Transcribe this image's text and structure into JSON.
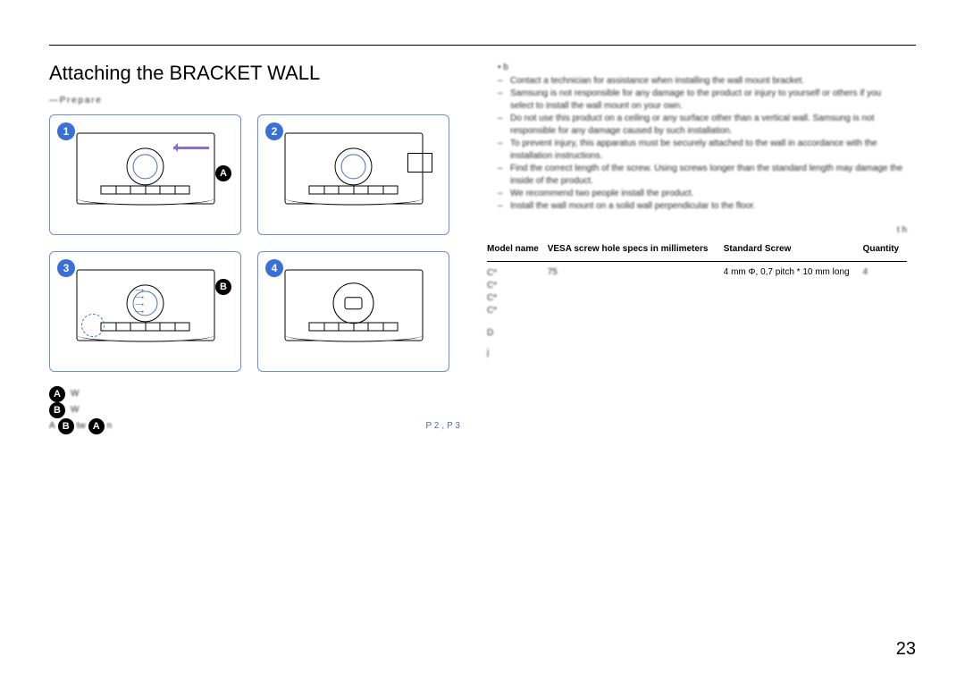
{
  "title": "Attaching the BRACKET WALL",
  "pre_note": "― P r e p a r e",
  "steps": {
    "s1": "1",
    "s2": "2",
    "s3": "3",
    "s4": "4"
  },
  "letters": {
    "A": "A",
    "B": "B"
  },
  "legend": {
    "a_text": "W",
    "b_text": "W",
    "line3_prefix": "A",
    "line3_b": "tw",
    "line3_a": "n",
    "link1": "P 2",
    "link_sep": " , ",
    "link2": "P 3"
  },
  "right": {
    "head_bullet": "b",
    "subs": [
      "Contact a technician for assistance when installing the wall mount bracket.",
      "Samsung is not responsible for any damage to the product or injury to yourself or others if you select to install the wall mount on your own.",
      "Do not use this product on a ceiling or any surface other than a vertical wall. Samsung is not responsible for any damage caused by such installation.",
      "To prevent injury, this apparatus must be securely attached to the wall in accordance with the installation instructions.",
      "Find the correct length of the screw. Using screws longer than the standard length may damage the inside of the product.",
      "We recommend two people install the product.",
      "Install the wall mount on a solid wall perpendicular to the floor."
    ],
    "pre_table_note": "t h"
  },
  "table": {
    "headers": {
      "model": "Model name",
      "vesa": "VESA screw hole specs in millimeters",
      "screw": "Standard Screw",
      "qty": "Quantity"
    },
    "row": {
      "models": [
        "C*",
        "C*",
        "C*",
        "C*"
      ],
      "vesa": "75",
      "screw": "4 mm Φ, 0,7 pitch * 10 mm long",
      "qty": "4"
    }
  },
  "footer_note_1": "D",
  "footer_note_2": "j",
  "page_number": "23"
}
